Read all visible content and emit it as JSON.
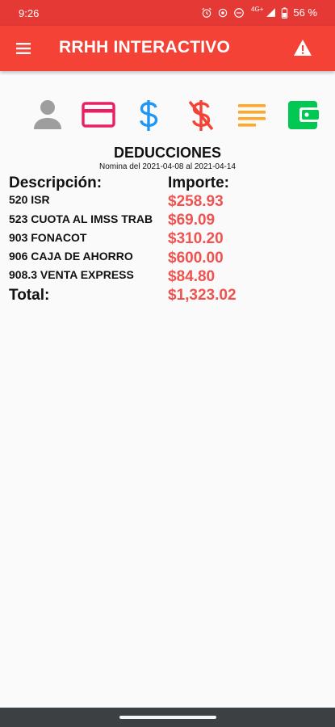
{
  "status_bar": {
    "time": "9:26",
    "network": "4G+",
    "battery": "56 %"
  },
  "app_bar": {
    "title": "RRHH INTERACTIVO"
  },
  "icons": [
    "person-icon",
    "credit-card-icon",
    "dollar-icon",
    "dollar-off-icon",
    "list-icon",
    "wallet-icon"
  ],
  "colors": {
    "primary": "#f44336",
    "amount": "#ef5350",
    "person": "#9e9e9e",
    "card": "#e91e63",
    "dollar": "#2196f3",
    "dollar_off": "#f44336",
    "list": "#ffa726",
    "wallet": "#00c853"
  },
  "section": {
    "title": "DEDUCCIONES",
    "period": "Nomina del 2021-04-08 al 2021-04-14"
  },
  "table": {
    "headers": [
      "Descripción:",
      "Importe:"
    ],
    "rows": [
      {
        "description": "520 ISR",
        "amount": "$258.93"
      },
      {
        "description": "523 CUOTA AL IMSS TRAB",
        "amount": "$69.09"
      },
      {
        "description": "903 FONACOT",
        "amount": "$310.20"
      },
      {
        "description": "906 CAJA DE AHORRO",
        "amount": "$600.00"
      },
      {
        "description": "908.3 VENTA EXPRESS",
        "amount": "$84.80"
      }
    ],
    "total_label": "Total:",
    "total_amount": "$1,323.02"
  }
}
